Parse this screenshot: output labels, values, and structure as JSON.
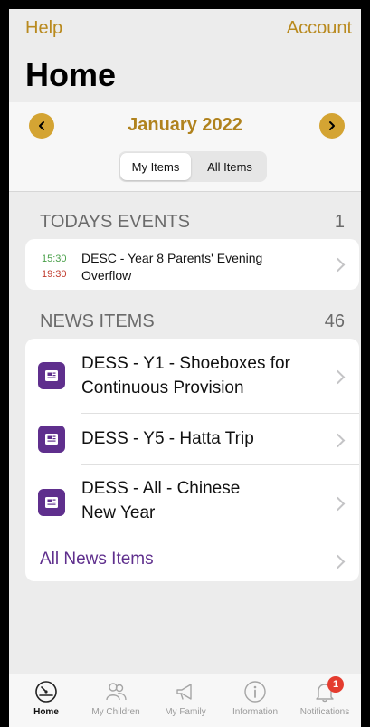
{
  "nav": {
    "left": "Help",
    "right": "Account"
  },
  "page_title": "Home",
  "month": {
    "label": "January 2022"
  },
  "segment": {
    "left": "My Items",
    "right": "All Items"
  },
  "events": {
    "header": "TODAYS EVENTS",
    "count": "1",
    "items": [
      {
        "start": "15:30",
        "end": "19:30",
        "title": "DESC - Year 8 Parents' Evening Overflow"
      }
    ]
  },
  "news": {
    "header": "NEWS ITEMS",
    "count": "46",
    "items": [
      {
        "title": "DESS - Y1 - Shoeboxes for Continuous Provision"
      },
      {
        "title": "DESS - Y5 - Hatta Trip"
      },
      {
        "title": "DESS - All - Chinese New Year"
      }
    ],
    "all_label": "All News Items"
  },
  "tabs": [
    {
      "label": "Home",
      "icon": "gauge-icon"
    },
    {
      "label": "My Children",
      "icon": "people-icon"
    },
    {
      "label": "My Family",
      "icon": "megaphone-icon"
    },
    {
      "label": "Information",
      "icon": "info-icon"
    },
    {
      "label": "Notifications",
      "icon": "bell-icon",
      "badge": "1"
    }
  ],
  "colors": {
    "accent": "#d4a433",
    "brand_purple": "#5f2f8d",
    "badge_red": "#e43c2f"
  }
}
